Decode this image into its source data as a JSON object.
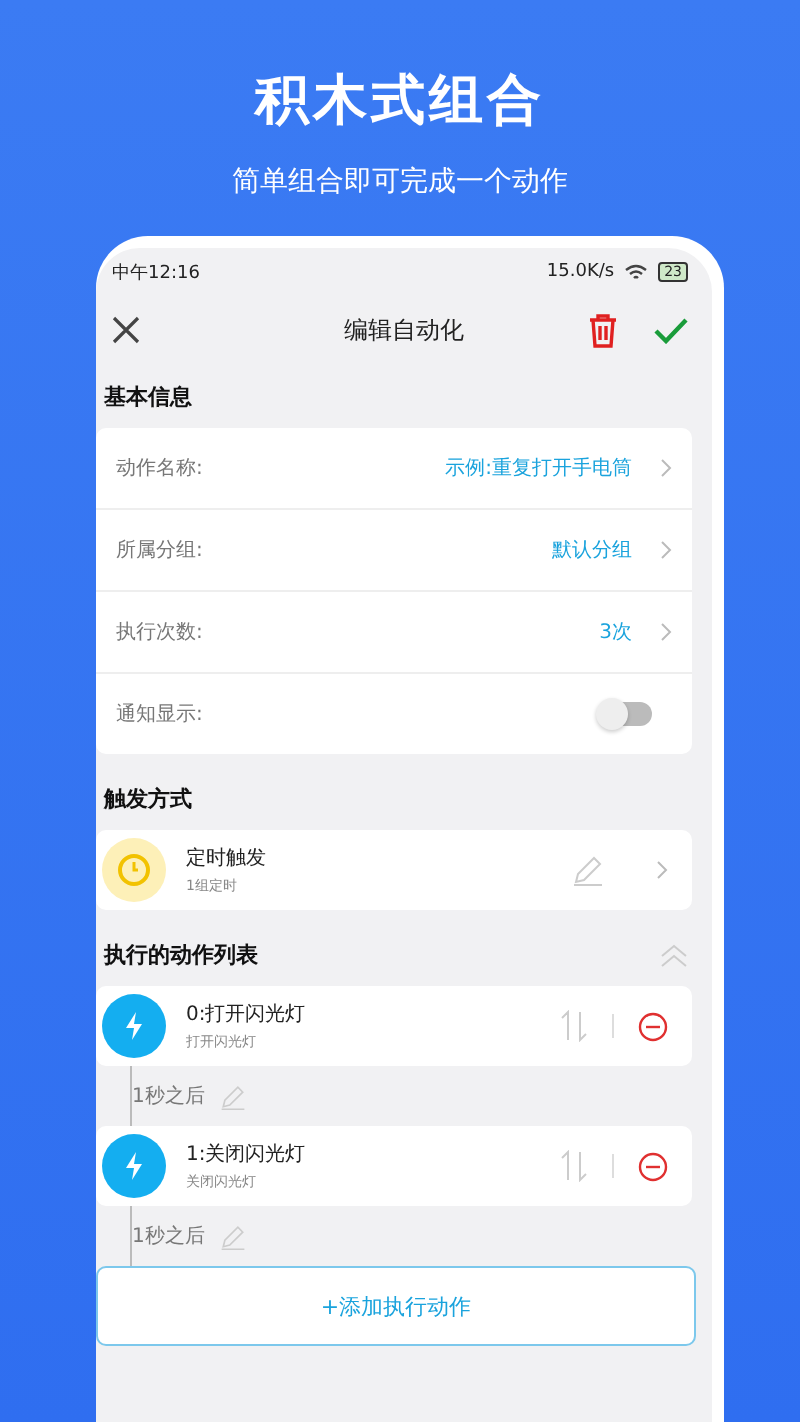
{
  "headline": "积木式组合",
  "subheadline": "简单组合即可完成一个动作",
  "status_bar": {
    "time": "中午12:16",
    "speed": "15.0K/s",
    "battery": "23"
  },
  "toolbar": {
    "title": "编辑自动化"
  },
  "basic_info": {
    "heading": "基本信息",
    "rows": [
      {
        "kind": "link",
        "label": "动作名称:",
        "value": "示例:重复打开手电筒"
      },
      {
        "kind": "link",
        "label": "所属分组:",
        "value": "默认分组"
      },
      {
        "kind": "link",
        "label": "执行次数:",
        "value": "3次"
      },
      {
        "kind": "toggle",
        "label": "通知显示:",
        "on": false
      }
    ]
  },
  "trigger": {
    "heading": "触发方式",
    "title": "定时触发",
    "subtitle": "1组定时"
  },
  "actions": {
    "heading": "执行的动作列表",
    "expanded": true,
    "items": [
      {
        "title": "0:打开闪光灯",
        "subtitle": "打开闪光灯",
        "delay": "1秒之后"
      },
      {
        "title": "1:关闭闪光灯",
        "subtitle": "关闭闪光灯",
        "delay": "1秒之后"
      }
    ],
    "add_button": "+添加执行动作"
  }
}
